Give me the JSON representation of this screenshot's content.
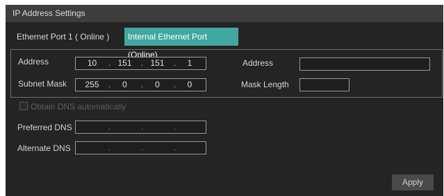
{
  "window": {
    "title": "IP Address Settings"
  },
  "tabs": [
    {
      "label": "Ethernet Port 1 ( Online )",
      "active": false
    },
    {
      "label": "Internal Ethernet Port (Online)",
      "active": true
    }
  ],
  "ipv4": {
    "address_label": "Address",
    "address": [
      "10",
      "151",
      "151",
      "1"
    ],
    "subnet_mask_label": "Subnet Mask",
    "subnet_mask": [
      "255",
      "0",
      "0",
      "0"
    ]
  },
  "ipv6": {
    "address_label": "Address",
    "address_value": "",
    "mask_length_label": "Mask Length",
    "mask_length_value": ""
  },
  "dns": {
    "obtain_auto_label": "Obtain DNS automatically",
    "obtain_auto_checked": false,
    "preferred_label": "Preferred DNS",
    "preferred": [
      "",
      "",
      "",
      ""
    ],
    "alternate_label": "Alternate DNS",
    "alternate": [
      "",
      "",
      "",
      ""
    ]
  },
  "footer": {
    "apply_label": "Apply"
  },
  "colors": {
    "active_tab": "#42a89f",
    "background": "#242424",
    "title_bar": "#3d3d3d"
  }
}
